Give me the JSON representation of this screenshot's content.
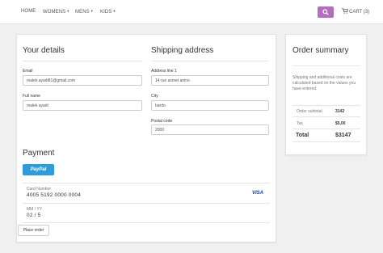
{
  "nav": {
    "items": [
      {
        "label": "HOME",
        "caret": false
      },
      {
        "label": "WOMENS",
        "caret": true
      },
      {
        "label": "MENS",
        "caret": true
      },
      {
        "label": "KIDS",
        "caret": true
      }
    ],
    "cart_label": "CART (3)",
    "accent_color": "#b56dc1"
  },
  "details": {
    "title": "Your details",
    "email_label": "Email",
    "email_value": "malek.ayadi81@gmail.com",
    "fullname_label": "Full name",
    "fullname_value": "malek ayadi"
  },
  "shipping": {
    "title": "Shipping address",
    "address_label": "Address line 1",
    "address_value": "14 rue asmet anino",
    "city_label": "City",
    "city_value": "bardo",
    "postal_label": "Postal code",
    "postal_value": "2000"
  },
  "payment": {
    "title": "Payment",
    "paypal_label": "PayPal",
    "card_number_label": "Card Number",
    "card_number_value": "4005 5192 0000 0004",
    "card_brand": "VISA",
    "expiry_label": "MM / YY",
    "expiry_value": "02 / 5",
    "place_order_label": "Place order"
  },
  "summary": {
    "title": "Order summary",
    "description": "Shipping and additional costs are calculated based on the values you have entered.",
    "subtotal_label": "Order subtotal",
    "subtotal_value": "3142",
    "tax_label": "Tax",
    "tax_value": "$5,00",
    "total_label": "Total",
    "total_value": "$3147"
  }
}
